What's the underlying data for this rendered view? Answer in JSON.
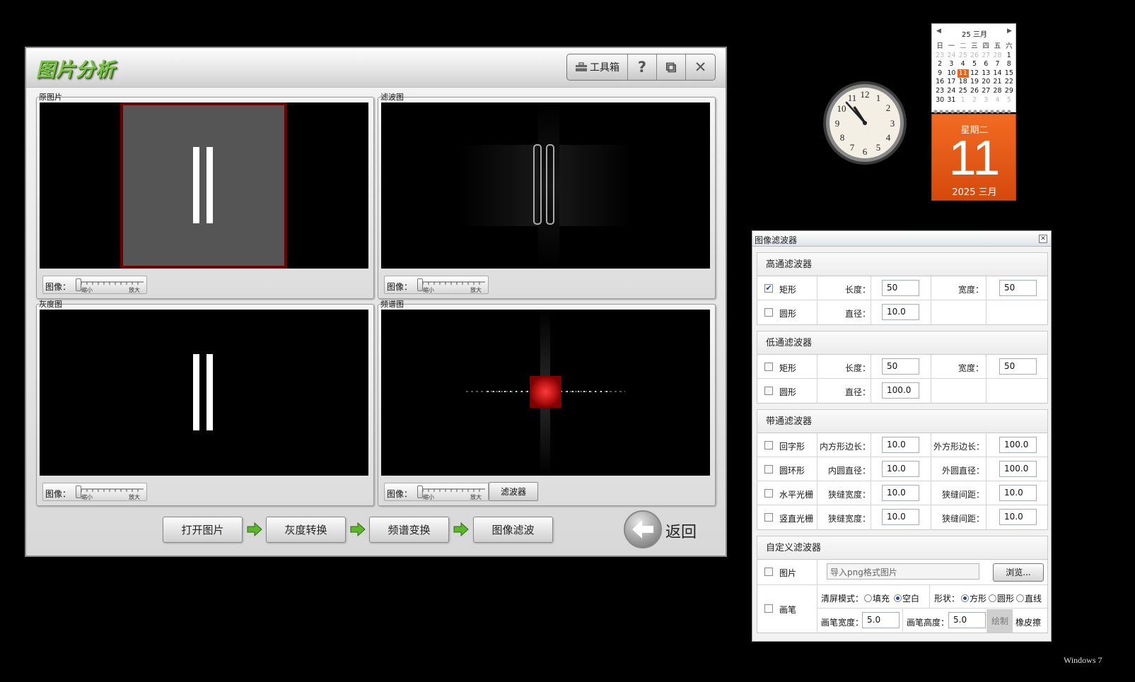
{
  "main_window": {
    "title": "图片分析",
    "toolbar": {
      "toolbox_label": "工具箱",
      "help_label": "?",
      "restore_label": "⧉",
      "close_label": "✕"
    },
    "panels": {
      "original": {
        "title": "原图片",
        "slider_label": "图像：",
        "min_label": "缩小",
        "max_label": "放大"
      },
      "filtered": {
        "title": "滤波图",
        "slider_label": "图像：",
        "min_label": "缩小",
        "max_label": "放大"
      },
      "gray": {
        "title": "灰度图",
        "slider_label": "图像：",
        "min_label": "缩小",
        "max_label": "放大"
      },
      "spectrum": {
        "title": "频谱图",
        "slider_label": "图像：",
        "min_label": "缩小",
        "max_label": "放大",
        "filter_button": "滤波器"
      }
    },
    "steps": [
      "打开图片",
      "灰度转换",
      "频谱变换",
      "图像滤波"
    ],
    "back_label": "返回"
  },
  "calendar": {
    "month_header": "25 三月",
    "weekdays": [
      "日",
      "一",
      "二",
      "三",
      "四",
      "五",
      "六"
    ],
    "weeks": [
      [
        "23",
        "24",
        "25",
        "26",
        "27",
        "28",
        "1"
      ],
      [
        "2",
        "3",
        "4",
        "5",
        "6",
        "7",
        "8"
      ],
      [
        "9",
        "10",
        "11",
        "12",
        "13",
        "14",
        "15"
      ],
      [
        "16",
        "17",
        "18",
        "19",
        "20",
        "21",
        "22"
      ],
      [
        "23",
        "24",
        "25",
        "26",
        "27",
        "28",
        "29"
      ],
      [
        "30",
        "31",
        "1",
        "2",
        "3",
        "4",
        "5"
      ]
    ],
    "weekday_label": "星期二",
    "day": "11",
    "year_month": "2025 三月",
    "accent": "#e8641c"
  },
  "clock": {
    "hour": 10,
    "minute": 53
  },
  "filter_dialog": {
    "title": "图像滤波器",
    "high_pass": {
      "title": "高通滤波器",
      "rect": {
        "label": "矩形",
        "checked": true,
        "length_label": "长度：",
        "length": "50",
        "width_label": "宽度：",
        "width": "50"
      },
      "circle": {
        "label": "圆形",
        "checked": false,
        "diameter_label": "直径：",
        "diameter": "10.0"
      }
    },
    "low_pass": {
      "title": "低通滤波器",
      "rect": {
        "label": "矩形",
        "checked": false,
        "length_label": "长度：",
        "length": "50",
        "width_label": "宽度：",
        "width": "50"
      },
      "circle": {
        "label": "圆形",
        "checked": false,
        "diameter_label": "直径：",
        "diameter": "100.0"
      }
    },
    "band_pass": {
      "title": "带通滤波器",
      "rows": [
        {
          "label": "回字形",
          "f1_label": "内方形边长：",
          "f1": "10.0",
          "f2_label": "外方形边长：",
          "f2": "100.0"
        },
        {
          "label": "圆环形",
          "f1_label": "内圆直径：",
          "f1": "10.0",
          "f2_label": "外圆直径：",
          "f2": "100.0"
        },
        {
          "label": "水平光栅",
          "f1_label": "狭缝宽度：",
          "f1": "10.0",
          "f2_label": "狭缝间距：",
          "f2": "10.0"
        },
        {
          "label": "竖直光栅",
          "f1_label": "狭缝宽度：",
          "f1": "10.0",
          "f2_label": "狭缝间距：",
          "f2": "10.0"
        }
      ]
    },
    "custom": {
      "title": "自定义滤波器",
      "image_label": "图片",
      "image_placeholder": "导入png格式图片",
      "browse_label": "浏览...",
      "pen_label": "画笔",
      "clear_mode_label": "清屏模式：",
      "fill_label": "填充",
      "blank_label": "空白",
      "shape_label": "形状：",
      "square_label": "方形",
      "circle_label": "圆形",
      "line_label": "直线",
      "pen_width_label": "画笔宽度：",
      "pen_width": "5.0",
      "pen_height_label": "画笔高度：",
      "pen_height": "5.0",
      "draw_label": "绘制",
      "eraser_label": "橡皮擦"
    }
  },
  "os_label": "Windows 7"
}
